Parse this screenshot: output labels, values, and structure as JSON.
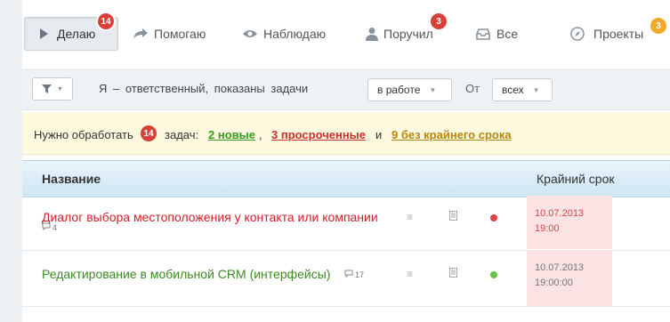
{
  "tabs": [
    {
      "label": "Делаю",
      "icon": "play-icon",
      "badge": "14",
      "badge_color": "#d8403a",
      "active": true
    },
    {
      "label": "Помогаю",
      "icon": "arrow-right-icon",
      "badge": null
    },
    {
      "label": "Наблюдаю",
      "icon": "eye-icon",
      "badge": null
    },
    {
      "label": "Поручил",
      "icon": "person-icon",
      "badge": "3",
      "badge_color": "#d8403a"
    },
    {
      "label": "Все",
      "icon": "inbox-icon",
      "badge": null
    },
    {
      "label": "Проекты",
      "icon": "compass-icon",
      "badge": "3",
      "badge_color": "#f0a92a"
    }
  ],
  "filter": {
    "text": "Я – ответственный, показаны задачи",
    "status_select": "в работе",
    "from_label": "От",
    "from_select": "всех"
  },
  "notice": {
    "prefix": "Нужно обработать",
    "badge": "14",
    "middle": "задач:",
    "new_link": "2 новые",
    "comma": ",",
    "overdue_link": "3 просроченные",
    "and": "и",
    "nodeadline_link": "9 без крайнего срока",
    "colors": {
      "new": "#3b9a1f",
      "overdue": "#c8312c",
      "nodeadline": "#b8860b"
    }
  },
  "table": {
    "headers": {
      "name": "Название",
      "deadline": "Крайний срок"
    },
    "rows": [
      {
        "title": "Диалог выбора местоположения у контакта или компании",
        "title_color": "#d0202a",
        "comments": "4",
        "status_color": "#e0404a",
        "deadline_date": "10.07.2013",
        "deadline_time": "19:00",
        "deadline_color": "#d0474b"
      },
      {
        "title": "Редактирование в мобильной CRM (интерфейсы)",
        "title_color": "#3c8a24",
        "comments": "17",
        "status_color": "#6cc04a",
        "deadline_date": "10.07.2013",
        "deadline_time": "19:00:00",
        "deadline_color": "#777777"
      }
    ]
  }
}
